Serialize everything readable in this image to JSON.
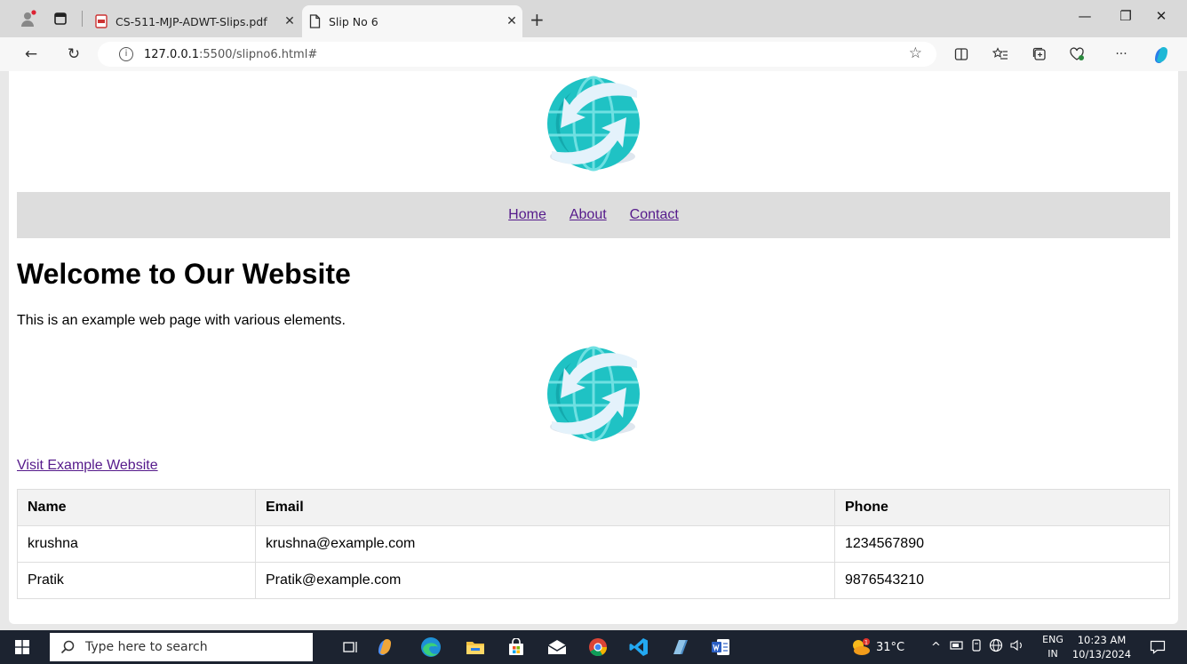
{
  "browser": {
    "tabs": [
      {
        "title": "CS-511-MJP-ADWT-Slips.pdf",
        "active": false
      },
      {
        "title": "Slip No 6",
        "active": true
      }
    ],
    "url_host": "127.0.0.1",
    "url_path": ":5500/slipno6.html#"
  },
  "page": {
    "nav": [
      "Home",
      "About",
      "Contact"
    ],
    "heading": "Welcome to Our Website",
    "paragraph": "This is an example web page with various elements.",
    "link": "Visit Example Website",
    "table": {
      "headers": [
        "Name",
        "Email",
        "Phone"
      ],
      "rows": [
        [
          "krushna",
          "krushna@example.com",
          "1234567890"
        ],
        [
          "Pratik",
          "Pratik@example.com",
          "9876543210"
        ]
      ]
    }
  },
  "taskbar": {
    "search_placeholder": "Type here to search",
    "temperature": "31°C",
    "lang_top": "ENG",
    "lang_bottom": "IN",
    "time": "10:23 AM",
    "date": "10/13/2024"
  },
  "colors": {
    "link_visited": "#551a8b",
    "nav_strip": "#dddddd",
    "logo_teal": "#1fc2c4",
    "taskbar_bg": "#1c2330"
  }
}
